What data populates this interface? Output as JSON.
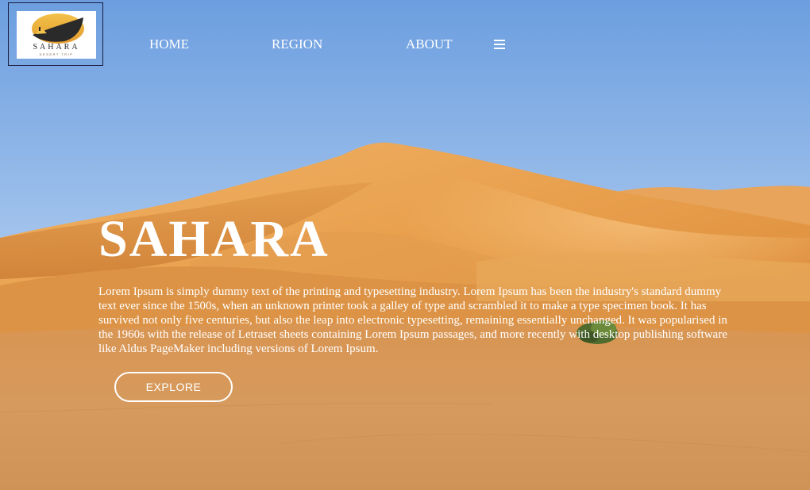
{
  "logo": {
    "name": "SAHARA",
    "tagline": "DESERT TRIP",
    "icon": "sun-camel-logo"
  },
  "nav": {
    "items": [
      {
        "label": "HOME"
      },
      {
        "label": "REGION"
      },
      {
        "label": "ABOUT"
      }
    ],
    "menu_icon": "hamburger-menu-icon"
  },
  "hero": {
    "title": "SAHARA",
    "description": "Lorem Ipsum is simply dummy text of the printing and typesetting industry. Lorem Ipsum has been the industry's standard dummy text ever since the 1500s, when an unknown printer took a galley of type and scrambled it to make a type specimen book. It has survived not only five centuries, but also the leap into electronic typesetting, remaining essentially unchanged. It was popularised in the 1960s with the release of Letraset sheets containing Lorem Ipsum passages, and more recently with desktop publishing software like Aldus PageMaker including versions of Lorem Ipsum.",
    "cta_label": "EXPLORE"
  },
  "colors": {
    "sky_top": "#6e9fe0",
    "sky_bottom": "#bcd4f0",
    "dune": "#e6a24f",
    "sand": "#d99a55",
    "text": "#ffffff"
  }
}
